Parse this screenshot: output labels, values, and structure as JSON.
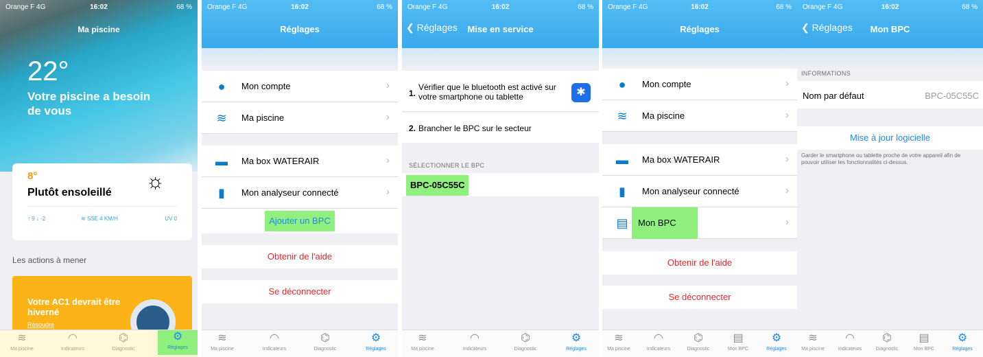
{
  "status": {
    "carrier": "Orange F 4G",
    "carrier_short": "Orange F",
    "network": "4G",
    "time": "16:02",
    "battery": "68 %"
  },
  "tabs": [
    "Ma piscine",
    "Indicateurs",
    "Diagnostic",
    "Réglages"
  ],
  "tabs5": [
    "Ma piscine",
    "Indicateurs",
    "Diagnostic",
    "Mon BPC",
    "Réglages"
  ],
  "icons": {
    "tab_piscine": "pool-icon",
    "tab_indicateurs": "gauge-icon",
    "tab_diagnostic": "diagnostic-icon",
    "tab_mon_bpc": "bpc-icon",
    "tab_reglages": "gear-icon"
  },
  "screen1": {
    "title": "Ma piscine",
    "temperature": "22°",
    "message": "Votre piscine a besoin de vous",
    "weather_temp": "8°",
    "weather_desc": "Plutôt ensoleillé",
    "minmax": "↑ 9 ↓ -2",
    "wind": "SSE 4 KM/H",
    "uv": "UV 0",
    "actions_title": "Les actions à mener",
    "action_title": "Votre AC1 devrait être hiverné",
    "action_link": "Résoudre"
  },
  "screen2": {
    "title": "Réglages",
    "rows": [
      "Mon compte",
      "Ma piscine",
      "Ma box WATERAIR",
      "Mon analyseur connecté"
    ],
    "add_bpc": "Ajouter un BPC",
    "help": "Obtenir de l'aide",
    "logout": "Se déconnecter"
  },
  "screen3": {
    "back": "Réglages",
    "title": "Mise en service",
    "step1_num": "1.",
    "step1": "Vérifier que le bluetooth est activé sur votre smartphone ou tablette",
    "step2_num": "2.",
    "step2": "Brancher le BPC sur le secteur",
    "section": "SÉLECTIONNER LE BPC",
    "device": "BPC-05C55C"
  },
  "screen4": {
    "title": "Réglages",
    "rows": [
      "Mon compte",
      "Ma piscine",
      "Ma box WATERAIR",
      "Mon analyseur connecté",
      "Mon BPC"
    ],
    "help": "Obtenir de l'aide",
    "logout": "Se déconnecter"
  },
  "screen5": {
    "back": "Réglages",
    "title": "Mon BPC",
    "section": "INFORMATIONS",
    "name_label": "Nom par défaut",
    "name_value": "BPC-05C55C",
    "update": "Mise à jour logicielle",
    "note": "Garder le smartphone ou tablette proche de votre appareil afin de pouvoir utiliser les fonctionnalités ci-dessus."
  },
  "colors": {
    "accent": "#1f8ae8",
    "highlight": "#8ff07d",
    "danger": "#e8262b",
    "nav": "#3fb1ee",
    "warning": "#fbb317"
  }
}
